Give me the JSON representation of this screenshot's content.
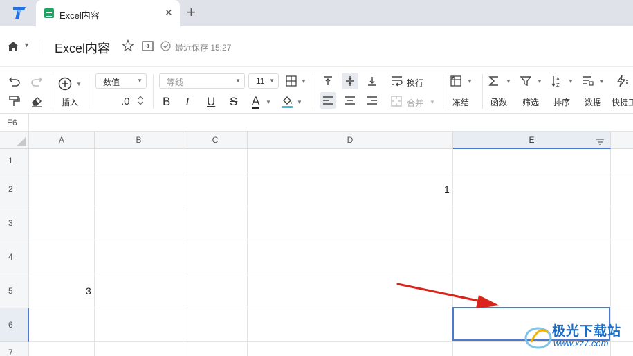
{
  "browser": {
    "tab_title": "Excel内容",
    "tab_close": "✕",
    "new_tab": "+"
  },
  "titlebar": {
    "doc_title": "Excel内容",
    "saved_text": "最近保存 15:27"
  },
  "toolbar": {
    "insert_label": "插入",
    "number_format": "数值",
    "decimal_label": ".0",
    "font_family": "等线",
    "font_size": "11",
    "bold": "B",
    "italic": "I",
    "underline": "U",
    "strike": "S",
    "font_color": "A",
    "wrap_label": "换行",
    "merge_label": "合并",
    "freeze_label": "冻结",
    "function_label": "函数",
    "filter_label": "筛选",
    "sort_label": "排序",
    "data_label": "数据",
    "quick_label": "快捷工"
  },
  "namebox": {
    "value": "E6"
  },
  "sheet": {
    "columns": [
      "A",
      "B",
      "C",
      "D",
      "E"
    ],
    "rows": [
      "1",
      "2",
      "3",
      "4",
      "5",
      "6",
      "7"
    ],
    "cells": {
      "D2": "1",
      "A5": "3"
    },
    "selected_cell": "E6"
  },
  "watermark": {
    "text": "极光下载站",
    "url": "www.xz7.com"
  },
  "colors": {
    "accent": "#4a7bd0",
    "arrow": "#d9241c",
    "tab_bar": "#dfe3e9"
  }
}
